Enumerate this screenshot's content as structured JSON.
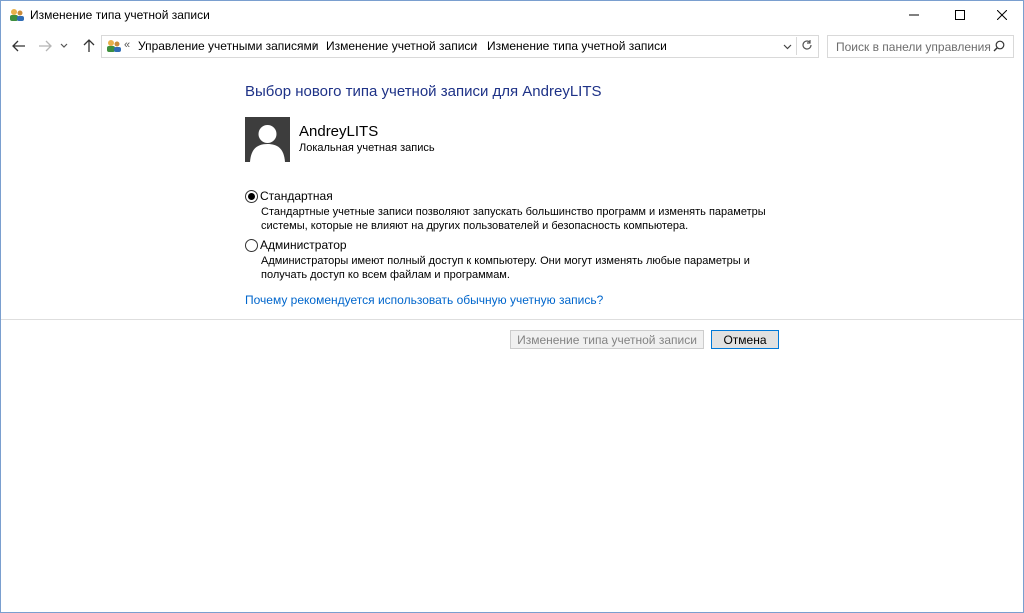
{
  "window": {
    "title": "Изменение типа учетной записи"
  },
  "address_bar": {
    "overflow": "«",
    "breadcrumbs": [
      "Управление учетными записями",
      "Изменение учетной записи",
      "Изменение типа учетной записи"
    ],
    "separator": "›"
  },
  "search": {
    "placeholder": "Поиск в панели управления"
  },
  "page": {
    "heading": "Выбор нового типа учетной записи для AndreyLITS",
    "user": {
      "name": "AndreyLITS",
      "account_type": "Локальная учетная запись"
    },
    "options": [
      {
        "label": "Стандартная",
        "selected": true,
        "description_lines": [
          "Стандартные учетные записи позволяют запускать большинство программ и изменять параметры",
          "системы, которые не влияют на других пользователей и безопасность компьютера."
        ]
      },
      {
        "label": "Администратор",
        "selected": false,
        "description_lines": [
          "Администраторы имеют полный доступ к компьютеру. Они могут изменять любые параметры и",
          "получать доступ ко всем файлам и программам."
        ]
      }
    ],
    "help_link": "Почему рекомендуется использовать обычную учетную запись?",
    "buttons": {
      "change": "Изменение типа учетной записи",
      "cancel": "Отмена"
    }
  },
  "colors": {
    "heading": "#1e3287",
    "link": "#0066cc",
    "window_border": "#7a9fcf",
    "avatar_bg": "#3d3d3d"
  }
}
